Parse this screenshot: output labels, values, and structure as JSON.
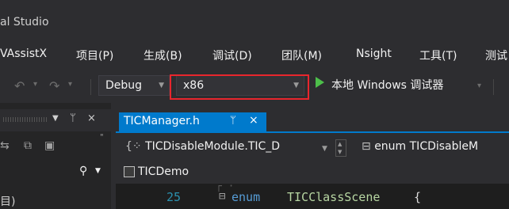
{
  "window": {
    "title": "al Studio"
  },
  "menu": {
    "items": [
      {
        "id": "assistx",
        "label": "VAssistX"
      },
      {
        "id": "project",
        "label": "项目(P)"
      },
      {
        "id": "build",
        "label": "生成(B)"
      },
      {
        "id": "debug",
        "label": "调试(D)"
      },
      {
        "id": "team",
        "label": "团队(M)"
      },
      {
        "id": "nsight",
        "label": "Nsight"
      },
      {
        "id": "tools",
        "label": "工具(T)"
      },
      {
        "id": "test",
        "label": "测试"
      }
    ]
  },
  "toolbar": {
    "configuration": "Debug",
    "platform": "x86",
    "run_label": "本地 Windows 调试器",
    "icons": [
      "undo-icon",
      "redo-icon",
      "play-icon"
    ]
  },
  "left_panel": {
    "pin": "ᛘ",
    "close": "×",
    "items": [
      "目)"
    ]
  },
  "editor": {
    "tab": {
      "label": "TICManager.h",
      "pin": "ᛘ",
      "close": "×"
    },
    "nav_scope": "TICDisableModule.TIC_D",
    "nav_member": "enum TICDisableM",
    "project": "TICDemo",
    "line_number": "25",
    "code_keyword": "enum",
    "code_identifier": "TICClassScene",
    "code_brace": "{"
  },
  "colors": {
    "accent": "#007acc",
    "highlight_box": "#e8262d",
    "run_green": "#4dbf4a",
    "background": "#2d2d30"
  }
}
